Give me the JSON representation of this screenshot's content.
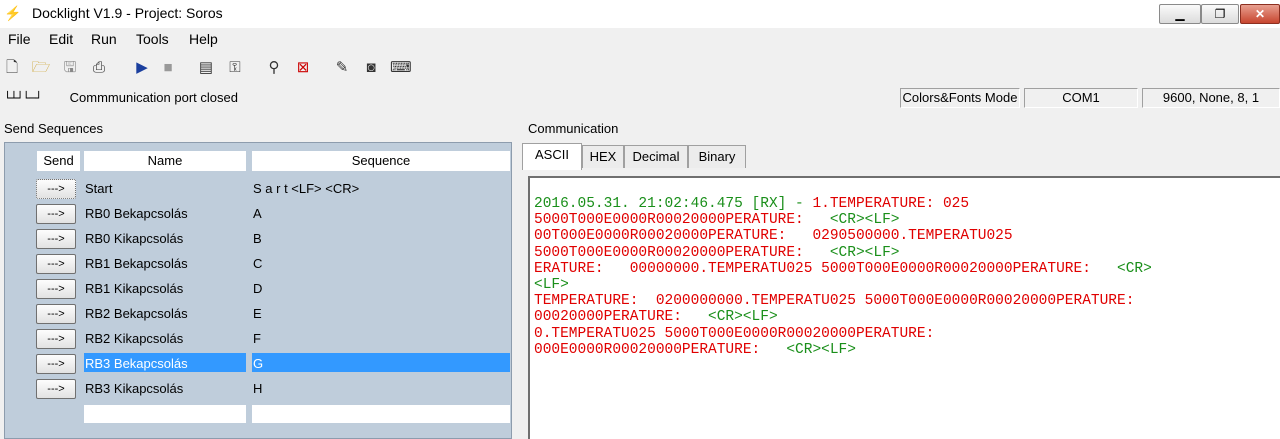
{
  "window": {
    "title": "Docklight V1.9 - Project: Soros",
    "minimize": "▁",
    "maximize": "❐",
    "close": "✕"
  },
  "menu": [
    "File",
    "Edit",
    "Run",
    "Tools",
    "Help"
  ],
  "toolbar": {
    "icons": [
      "new-document-icon",
      "open-folder-icon",
      "save-icon",
      "print-icon",
      "play-icon",
      "stop-icon",
      "project-settings-icon",
      "keyboard-settings-icon",
      "find-icon",
      "clear-icon",
      "edit-notes-icon",
      "snapshot-icon",
      "keyboard-console-icon"
    ]
  },
  "status": {
    "signal_glyph": "└┴┘└─┘",
    "message": "Commmunication port closed",
    "mode": "Colors&Fonts Mode",
    "port": "COM1",
    "settings": "9600, None, 8, 1"
  },
  "send_panel": {
    "label": "Send Sequences",
    "col_send": "Send",
    "col_name": "Name",
    "col_sequence": "Sequence",
    "button_label": "--->",
    "rows": [
      {
        "name": "Start",
        "sequence": "S a r t <LF> <CR>",
        "selected": false
      },
      {
        "name": "RB0 Bekapcsolás",
        "sequence": "A",
        "selected": false
      },
      {
        "name": "RB0 Kikapcsolás",
        "sequence": "B",
        "selected": false
      },
      {
        "name": "RB1 Bekapcsolás",
        "sequence": "C",
        "selected": false
      },
      {
        "name": "RB1 Kikapcsolás",
        "sequence": "D",
        "selected": false
      },
      {
        "name": "RB2 Bekapcsolás",
        "sequence": "E",
        "selected": false
      },
      {
        "name": "RB2 Kikapcsolás",
        "sequence": "F",
        "selected": false
      },
      {
        "name": "RB3 Bekapcsolás",
        "sequence": "G",
        "selected": true
      },
      {
        "name": "RB3 Kikapcsolás",
        "sequence": "H",
        "selected": false
      }
    ]
  },
  "comm_panel": {
    "label": "Communication",
    "tabs": [
      "ASCII",
      "HEX",
      "Decimal",
      "Binary"
    ],
    "active_tab": "ASCII",
    "lines": [
      [
        [
          "g",
          "2016.05.31. 21:02:46.475 [RX] - "
        ],
        [
          "r",
          "1.TEMPERATURE: 025"
        ]
      ],
      [
        [
          "r",
          "5000T000E0000R00020000PERATURE:   "
        ],
        [
          "g",
          "<CR><LF>"
        ]
      ],
      [
        [
          "r",
          "00T000E0000R00020000PERATURE:   0290500000.TEMPERATU025"
        ]
      ],
      [
        [
          "r",
          "5000T000E0000R00020000PERATURE:   "
        ],
        [
          "g",
          "<CR><LF>"
        ]
      ],
      [
        [
          "r",
          "ERATURE:   00000000.TEMPERATU025 5000T000E0000R00020000PERATURE:   "
        ],
        [
          "g",
          "<CR>"
        ]
      ],
      [
        [
          "g",
          "<LF>"
        ]
      ],
      [
        [
          "r",
          "TEMPERATURE:  0200000000.TEMPERATU025 5000T000E0000R00020000PERATURE:"
        ]
      ],
      [
        [
          "r",
          "00020000PERATURE:   "
        ],
        [
          "g",
          "<CR><LF>"
        ]
      ],
      [
        [
          "r",
          "0.TEMPERATU025 5000T000E0000R00020000PERATURE:"
        ]
      ],
      [
        [
          "r",
          "000E0000R00020000PERATURE:   "
        ],
        [
          "g",
          "<CR><LF>"
        ]
      ]
    ],
    "colors": {
      "rx_green": "#1a8f1a",
      "data_red": "#e00000"
    }
  }
}
